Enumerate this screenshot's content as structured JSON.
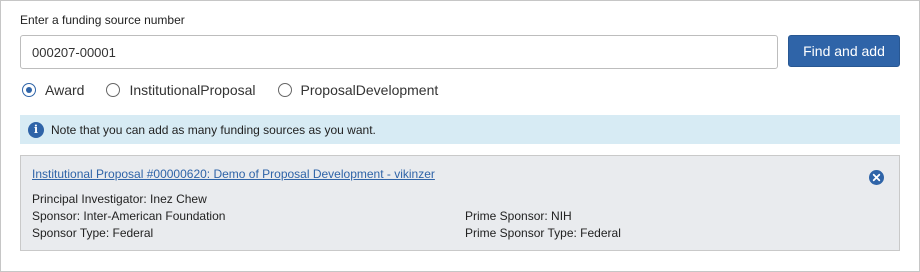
{
  "form": {
    "label": "Enter a funding source number",
    "input_value": "000207-00001",
    "find_button": "Find and add"
  },
  "source_types": [
    {
      "label": "Award",
      "selected": true
    },
    {
      "label": "InstitutionalProposal",
      "selected": false
    },
    {
      "label": "ProposalDevelopment",
      "selected": false
    }
  ],
  "info": {
    "icon": "info-icon",
    "text": "Note that you can add as many funding sources as you want."
  },
  "funding_source": {
    "title": "Institutional Proposal #00000620: Demo of Proposal Development - vikinzer",
    "principal_investigator": "Principal Investigator: Inez Chew",
    "sponsor": "Sponsor: Inter-American Foundation",
    "sponsor_type": "Sponsor Type: Federal",
    "prime_sponsor": "Prime Sponsor: NIH",
    "prime_sponsor_type": "Prime Sponsor Type: Federal",
    "remove_icon": "close-circle-icon"
  },
  "colors": {
    "accent": "#2f64a8",
    "info_background": "#d7ebf4",
    "card_background": "#e9ebee"
  }
}
